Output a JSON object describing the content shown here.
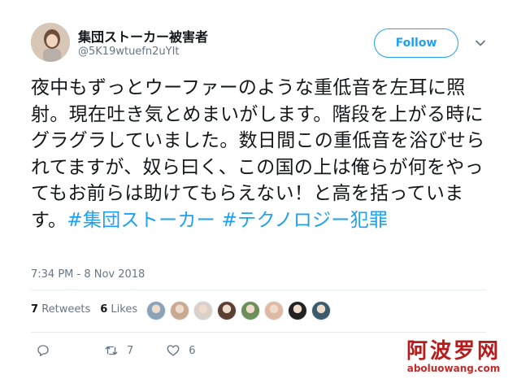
{
  "author": {
    "display_name": "集団ストーカー被害者",
    "handle": "@5K19wtuefn2uYIt"
  },
  "follow_button": {
    "label": "Follow"
  },
  "tweet": {
    "text": "夜中もずっとウーファーのような重低音を左耳に照射。現在吐き気とめまいがします。階段を上がる時にグラグラしていました。数日間この重低音を浴びせられてますが、奴ら曰く、この国の上は俺らが何をやってもお前らは助けてもらえない！と高を括っています。",
    "hashtags": [
      "#集団ストーカー",
      "#テクノロジー犯罪"
    ],
    "timestamp": "7:34 PM - 8 Nov 2018"
  },
  "stats": {
    "retweets_count": "7",
    "retweets_label": "Retweets",
    "likes_count": "6",
    "likes_label": "Likes"
  },
  "facepile_colors": [
    "#8aa3b8",
    "#c9a98f",
    "#d9d1c8",
    "#5a4030",
    "#6c8f5a",
    "#e0b9a4",
    "#222222",
    "#3c5a6e"
  ],
  "actions": {
    "reply_icon": "reply-icon",
    "retweet_icon": "retweet-icon",
    "retweet_count": "7",
    "like_icon": "heart-icon",
    "like_count": "6"
  },
  "watermark": {
    "chinese": "阿波罗网",
    "url": "aboluowang.com"
  },
  "colors": {
    "accent": "#1da1f2",
    "text": "#14171a",
    "secondary": "#657786",
    "watermark": "#c62828"
  }
}
